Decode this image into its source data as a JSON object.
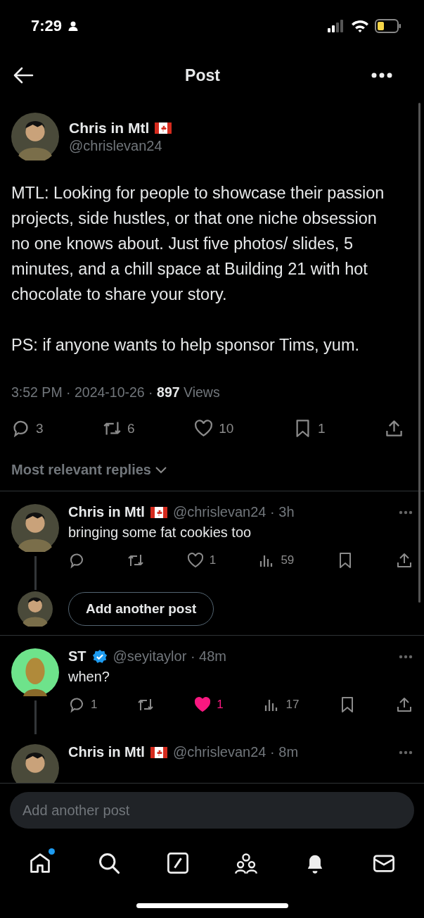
{
  "status_bar": {
    "time": "7:29"
  },
  "header": {
    "title": "Post"
  },
  "post": {
    "name": "Chris in Mtl",
    "flag": true,
    "handle": "@chrislevan24",
    "paragraphs": [
      "MTL: Looking for people to showcase their passion projects, side hustles, or that one niche obsession no one knows about. Just five photos/ slides, 5 minutes, and a chill space at Building 21 with hot chocolate to share your story.",
      "PS: if anyone wants to help sponsor Tims, yum."
    ],
    "time": "3:52 PM ·",
    "date": "2024-10-26 ·",
    "views": "897",
    "views_label": "Views",
    "actions": [
      {
        "kind": "reply",
        "count": "3"
      },
      {
        "kind": "repost",
        "count": "6"
      },
      {
        "kind": "like",
        "count": "10",
        "liked": false
      },
      {
        "kind": "bookmark",
        "count": "1"
      },
      {
        "kind": "share"
      }
    ]
  },
  "sort": {
    "label": "Most relevant replies"
  },
  "replies": [
    {
      "kind": "reply",
      "avatar": {
        "color": "#4a4a3a"
      },
      "name": "Chris in Mtl",
      "flag": true,
      "verified": false,
      "handle": "@chrislevan24",
      "time": "· 3h",
      "text": "bringing some fat cookies too",
      "thread": true,
      "actions": [
        {
          "kind": "reply"
        },
        {
          "kind": "repost"
        },
        {
          "kind": "like",
          "count": "1",
          "liked": false
        },
        {
          "kind": "views",
          "count": "59"
        },
        {
          "kind": "bookmark"
        },
        {
          "kind": "share"
        }
      ]
    },
    {
      "kind": "add_post",
      "avatar": {
        "color": "#4a4a3a"
      },
      "label": "Add another post"
    },
    {
      "kind": "reply",
      "avatar": {
        "color": "#6ee38b"
      },
      "name": "ST",
      "flag": false,
      "verified": true,
      "handle": "@seyitaylor",
      "time": "· 48m",
      "text": "when?",
      "thread": true,
      "actions": [
        {
          "kind": "reply",
          "count": "1"
        },
        {
          "kind": "repost"
        },
        {
          "kind": "like",
          "count": "1",
          "liked": true
        },
        {
          "kind": "views",
          "count": "17"
        },
        {
          "kind": "bookmark"
        },
        {
          "kind": "share"
        }
      ]
    },
    {
      "kind": "partial",
      "avatar": {
        "color": "#4a4a3a"
      },
      "name": "Chris in Mtl",
      "flag": true,
      "handle": "@chrislevan24",
      "time": "· 8m"
    }
  ],
  "composer": {
    "placeholder": "Add another post"
  },
  "tab_bar": [
    {
      "kind": "home",
      "dot": true
    },
    {
      "kind": "search",
      "dot": false
    },
    {
      "kind": "grok",
      "dot": false
    },
    {
      "kind": "communities",
      "dot": false
    },
    {
      "kind": "notifications",
      "dot": false
    },
    {
      "kind": "messages",
      "dot": false
    }
  ]
}
